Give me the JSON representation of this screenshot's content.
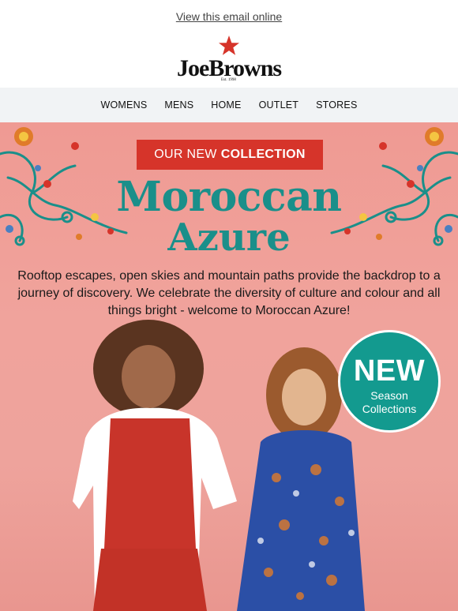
{
  "header": {
    "view_online": "View this email online",
    "logo_text": "JoeBrowns",
    "logo_est": "Est. 1998",
    "brand_color": "#d6342a"
  },
  "nav": {
    "items": [
      "WOMENS",
      "MENS",
      "HOME",
      "OUTLET",
      "STORES"
    ]
  },
  "hero": {
    "banner_plain": "OUR NEW",
    "banner_bold": "COLLECTION",
    "title_line1": "Moroccan",
    "title_line2": "Azure",
    "description": "Rooftop escapes, open skies and mountain paths provide the backdrop to a journey of discovery. We celebrate the diversity of culture and colour and all things bright - welcome to Moroccan Azure!",
    "accent_color": "#1a8f8a",
    "background_color": "#f0a39c",
    "badge": {
      "title": "NEW",
      "line1": "Season",
      "line2": "Collections",
      "color": "#139a8f"
    }
  },
  "icons": {
    "star": "star-icon",
    "ornament": "floral-ornament-icon"
  }
}
